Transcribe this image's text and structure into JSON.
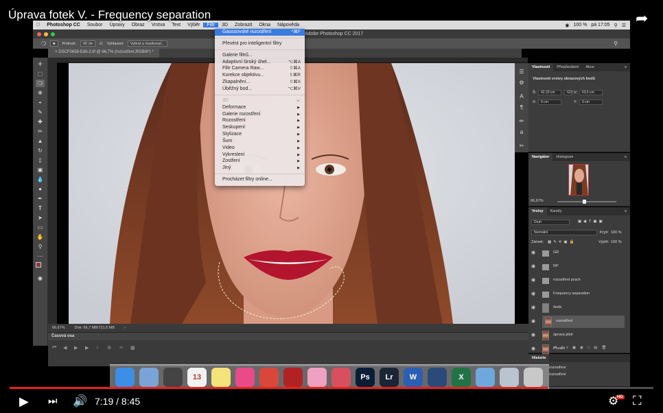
{
  "video": {
    "title": "Úprava fotek V. - Frequency separation",
    "time": "7:19 / 8:45",
    "progress": 0.836,
    "hd_badge": "HD",
    "colors": {
      "progress": "#e8221a"
    }
  },
  "mac_menubar": {
    "apple": "",
    "app": "Photoshop CC",
    "items": [
      "Soubor",
      "Úpravy",
      "Obraz",
      "Vrstva",
      "Text",
      "Výběr",
      "Filtr",
      "3D",
      "Zobrazit",
      "Okna",
      "Nápověda"
    ],
    "active_item": "Filtr",
    "battery": "100 %",
    "clock": "pá 17:05"
  },
  "window": {
    "title": "Adobe Photoshop CC 2017"
  },
  "options_bar": {
    "feather_label": "Prolnutí:",
    "feather_value": "60 ob",
    "antialias_label": "Vyhlazení",
    "select_mask_button": "Vybrat a maskovat..."
  },
  "document": {
    "tab": "DSCF0658-Edit-2.tif @ 66,7% (rozostření,RGB/8*) *",
    "zoom": "66,67%",
    "doc_info": "Dok: 66,7 MB/721,6 MB",
    "ruler_ticks": [
      "0",
      "2",
      "4",
      "6",
      "8",
      "10",
      "12",
      "14",
      "16",
      "18",
      "20",
      "22",
      "24",
      "26",
      "28",
      "30",
      "32",
      "34",
      "36",
      "38",
      "40"
    ]
  },
  "filter_menu": {
    "items": [
      {
        "label": "Gaussovské rozostření",
        "shortcut": "^⌘F",
        "highlighted": true
      },
      {
        "sep": true
      },
      {
        "label": "Převést pro inteligentní filtry"
      },
      {
        "sep": true
      },
      {
        "label": "Galerie filtrů..."
      },
      {
        "label": "Adaptivní široký úhel...",
        "shortcut": "⌥⌘A"
      },
      {
        "label": "Filtr Camera Raw...",
        "shortcut": "⇧⌘A"
      },
      {
        "label": "Korekce objektivu...",
        "shortcut": "⇧⌘R"
      },
      {
        "label": "Zkapalnění...",
        "shortcut": "⇧⌘X"
      },
      {
        "label": "Úběžný bod...",
        "shortcut": "⌥⌘V"
      },
      {
        "sep": true
      },
      {
        "label": "3D",
        "submenu": true,
        "disabled": true
      },
      {
        "label": "Deformace",
        "submenu": true
      },
      {
        "label": "Galerie rozostření",
        "submenu": true
      },
      {
        "label": "Rozostření",
        "submenu": true
      },
      {
        "label": "Seskupení",
        "submenu": true
      },
      {
        "label": "Stylizace",
        "submenu": true
      },
      {
        "label": "Šum",
        "submenu": true
      },
      {
        "label": "Video",
        "submenu": true
      },
      {
        "label": "Vykreslení",
        "submenu": true
      },
      {
        "label": "Zostření",
        "submenu": true
      },
      {
        "label": "Jiný",
        "submenu": true
      },
      {
        "sep": true
      },
      {
        "label": "Procházet filtry online..."
      }
    ]
  },
  "properties_panel": {
    "tabs": [
      "Vlastnosti",
      "Přizpůsobení",
      "Akce"
    ],
    "subtitle": "Vlastnosti vrstvy obrazových bodů",
    "w_label": "Š:",
    "w_value": "42,33 cm",
    "link_label": "GO",
    "h_label": "V:",
    "h_value": "63,5 cm",
    "x_label": "X:",
    "x_value": "0 cm",
    "y_label": "Y:",
    "y_value": "0 cm"
  },
  "navigator_panel": {
    "tabs": [
      "Navigátor",
      "Histogram"
    ],
    "zoom": "66,67%"
  },
  "layers_panel": {
    "tabs": [
      "Vrstvy",
      "Kanály"
    ],
    "filter_kind": "Druh",
    "blend_mode": "Normální",
    "opacity_label": "Krytí:",
    "opacity_value": "100 %",
    "lock_label": "Zámek:",
    "fill_label": "Výplň:",
    "fill_value": "100 %",
    "layers": [
      {
        "name": "GR",
        "type": "group"
      },
      {
        "name": "RP",
        "type": "group"
      },
      {
        "name": "rozostření prach",
        "type": "group"
      },
      {
        "name": "Frequency separation",
        "type": "group-open"
      },
      {
        "name": "šedá",
        "type": "gray"
      },
      {
        "name": "rozostření",
        "type": "photo",
        "selected": true
      },
      {
        "name": "úprava pleti",
        "type": "photo"
      },
      {
        "name": "Pozadí",
        "type": "photo"
      }
    ]
  },
  "history_panel": {
    "title": "Historie",
    "items": [
      "rozostření",
      "rozostření"
    ]
  },
  "timeline_panel": {
    "title": "Časová osa"
  },
  "dock": {
    "apps": [
      {
        "name": "finder-icon",
        "color": "#3d8ee6",
        "label": ""
      },
      {
        "name": "preview-icon",
        "color": "#7aa3d6",
        "label": ""
      },
      {
        "name": "compass-icon",
        "color": "#444444",
        "label": ""
      },
      {
        "name": "calendar-icon",
        "color": "#f2f2f2",
        "label": "13"
      },
      {
        "name": "notes-icon",
        "color": "#f4e27a",
        "label": ""
      },
      {
        "name": "itunes-icon",
        "color": "#e84a8a",
        "label": ""
      },
      {
        "name": "chrome-icon",
        "color": "#d9473c",
        "label": ""
      },
      {
        "name": "photobooth-icon",
        "color": "#b22222",
        "label": ""
      },
      {
        "name": "photos-icon",
        "color": "#f0a0c0",
        "label": ""
      },
      {
        "name": "dictionary-icon",
        "color": "#d85060",
        "label": ""
      },
      {
        "name": "photoshop-icon",
        "color": "#0b1d35",
        "label": "Ps"
      },
      {
        "name": "lightroom-icon",
        "color": "#1a2535",
        "label": "Lr"
      },
      {
        "name": "word-icon",
        "color": "#2b5fb4",
        "label": "W"
      },
      {
        "name": "quicktime-icon",
        "color": "#2a4a7a",
        "label": ""
      },
      {
        "name": "excel-icon",
        "color": "#217346",
        "label": "X"
      },
      {
        "name": "folder-icon",
        "color": "#6fa8dc",
        "label": ""
      },
      {
        "name": "screenshots-icon",
        "color": "#b8c4d0",
        "label": ""
      },
      {
        "name": "trash-icon",
        "color": "#c8c8c8",
        "label": ""
      }
    ]
  }
}
